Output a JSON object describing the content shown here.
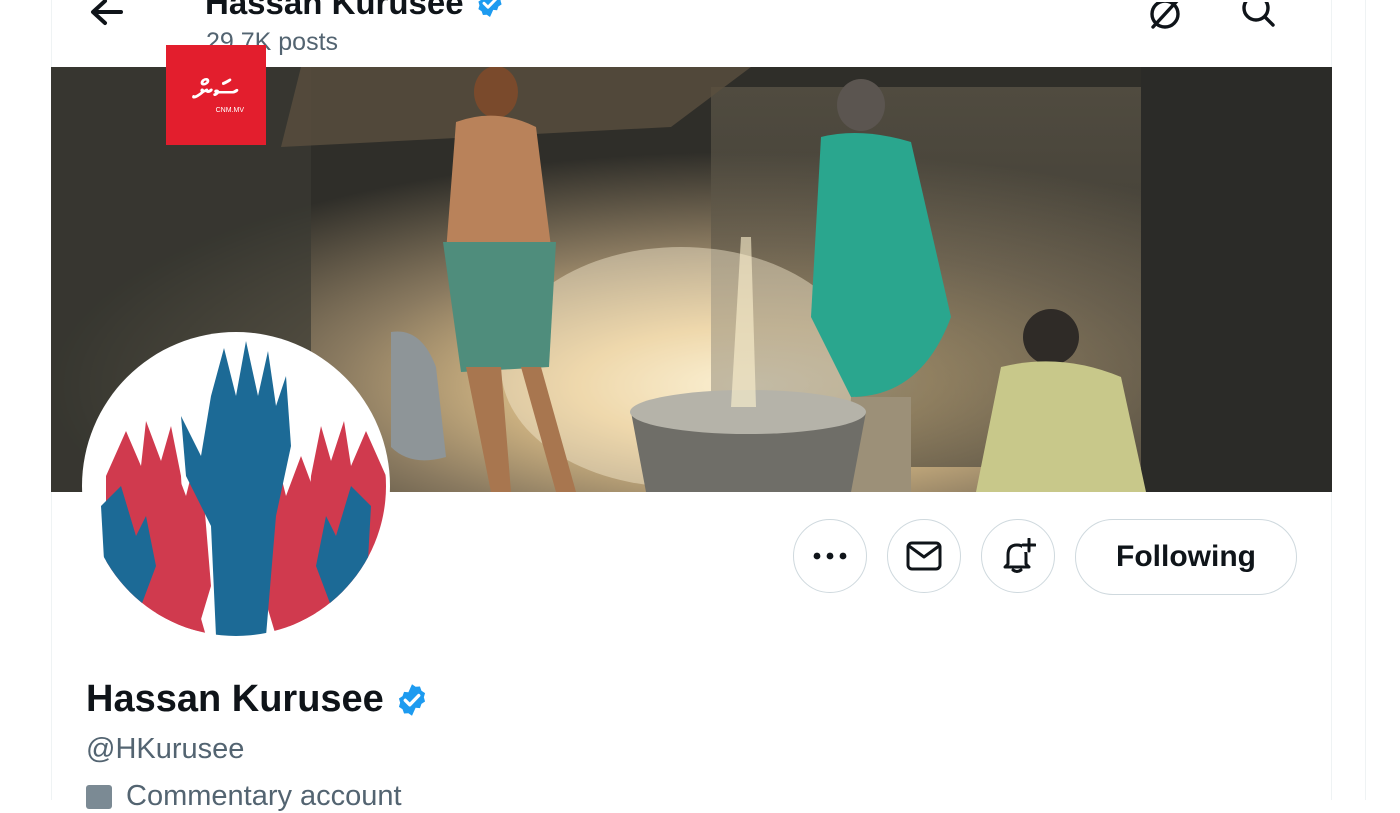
{
  "header": {
    "title": "Hassan Kurusee",
    "posts_count": "29.7K posts"
  },
  "watermark": {
    "logo_text": "ސަން",
    "domain": "CNM.MV"
  },
  "profile": {
    "name": "Hassan Kurusee",
    "handle": "@HKurusee",
    "category": "Commentary account",
    "verified": true
  },
  "actions": {
    "following_label": "Following"
  },
  "colors": {
    "verified": "#1d9bf0",
    "logo_bg": "#e31e2d",
    "hand_blue": "#1c6a96",
    "hand_red": "#d03a4e"
  }
}
